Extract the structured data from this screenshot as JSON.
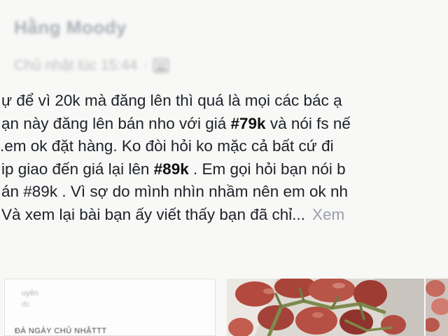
{
  "post": {
    "author": "Hằng Moody",
    "timestamp": "Chủ nhật lúc 15:44",
    "separator": "·",
    "audience_icon": "friends-icon",
    "text_lines": [
      {
        "parts": [
          {
            "t": "ự để vì 20k mà đăng lên thì quá là mọi các bác ạ",
            "b": false
          }
        ]
      },
      {
        "parts": [
          {
            "t": "ạn này đăng lên bán nho với giá ",
            "b": false
          },
          {
            "t": "#79k",
            "b": true
          },
          {
            "t": " và nói fs nế",
            "b": false
          }
        ]
      },
      {
        "parts": [
          {
            "t": " .em ok đặt hàng. Ko đòi hỏi ko mặc cả bất cứ đi",
            "b": false
          }
        ]
      },
      {
        "parts": [
          {
            "t": "ip giao đến giá lại lên ",
            "b": false
          },
          {
            "t": "#89k",
            "b": true
          },
          {
            "t": " . Em gọi hỏi bạn nói b",
            "b": false
          }
        ]
      },
      {
        "parts": [
          {
            "t": "án #89k . Vì sợ do mình nhìn nhầm nên em ok nh",
            "b": false
          }
        ]
      },
      {
        "parts": [
          {
            "t": " Và xem lại bài bạn ấy viết thấy bạn đã chỉ...",
            "b": false
          }
        ]
      }
    ],
    "see_more": "Xem"
  },
  "attachments": {
    "left_preview": {
      "line1": "uyên",
      "line2": "dc",
      "line3": "ĐÀ NGÀY CHỦ NHẬTTT"
    },
    "colors": {
      "grape": "#b0483d",
      "grape_dark": "#7d2a22",
      "stem": "#7d8a4c",
      "paper": "#e4e1db"
    }
  }
}
